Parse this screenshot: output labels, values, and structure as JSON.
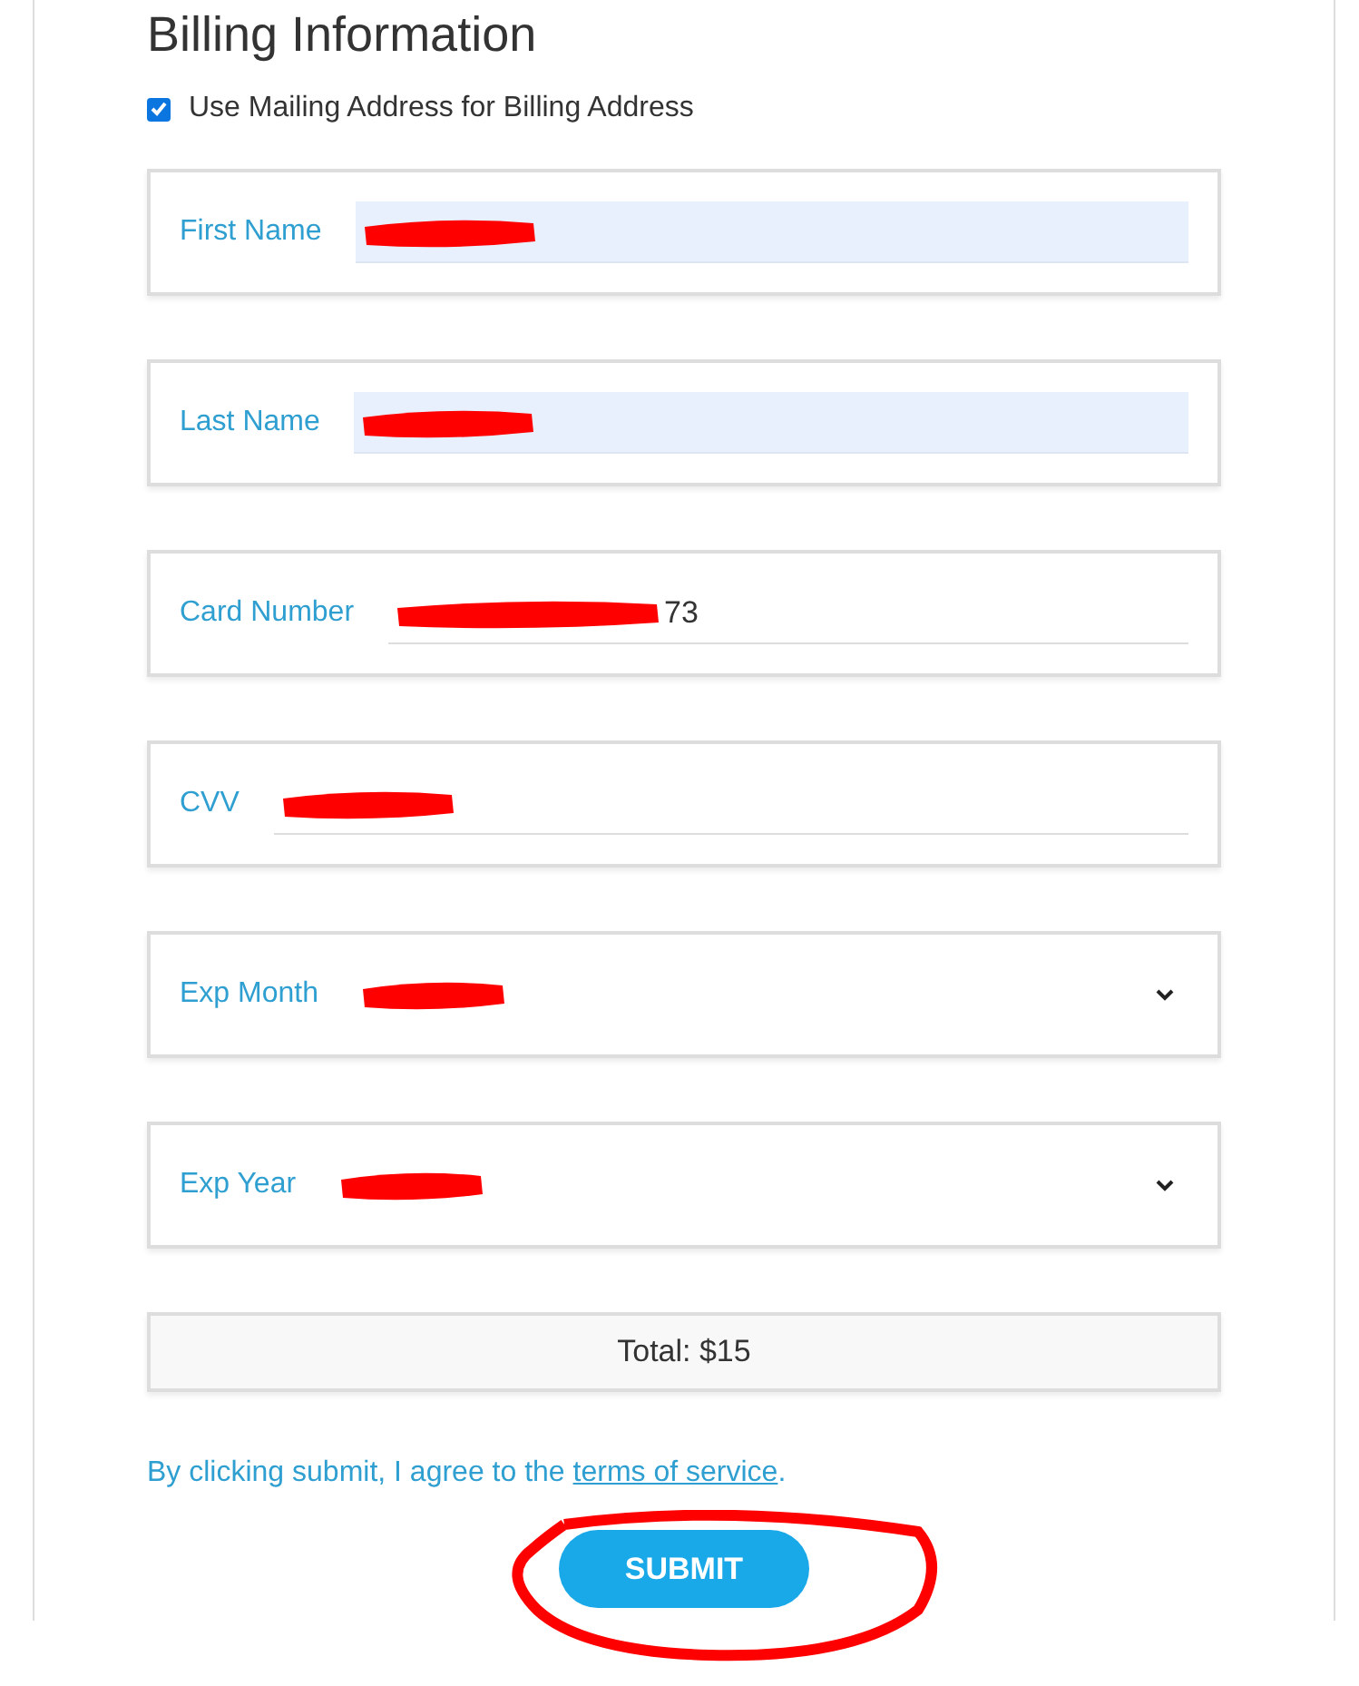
{
  "title": "Billing Information",
  "use_mailing": {
    "label": "Use Mailing Address for Billing Address",
    "checked": true
  },
  "fields": [
    {
      "kind": "text",
      "label": "First Name",
      "autofilled": true,
      "redacted": true
    },
    {
      "kind": "text",
      "label": "Last Name",
      "autofilled": true,
      "redacted": true
    },
    {
      "kind": "text",
      "label": "Card Number",
      "autofilled": false,
      "redacted": true,
      "value": "73"
    },
    {
      "kind": "text",
      "label": "CVV",
      "autofilled": false,
      "redacted": true
    },
    {
      "kind": "select",
      "label": "Exp Month",
      "redacted": true
    },
    {
      "kind": "select",
      "label": "Exp Year",
      "redacted": true
    }
  ],
  "total": "Total: $15",
  "agreement": {
    "text": "By clicking submit, I agree to the ",
    "link": "terms of service",
    "end": "."
  },
  "submit": {
    "label": "SUBMIT",
    "circled": true
  }
}
